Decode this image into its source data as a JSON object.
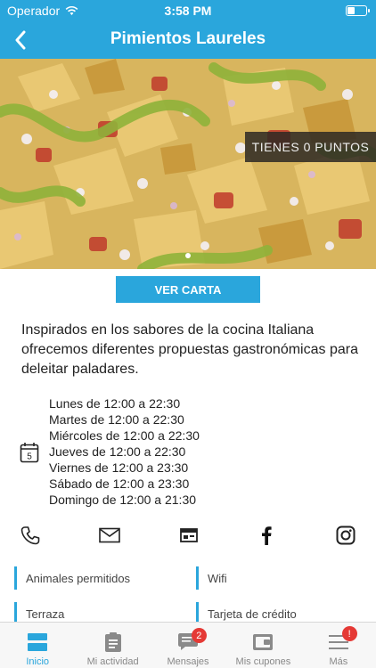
{
  "status_bar": {
    "carrier": "Operador",
    "time": "3:58 PM"
  },
  "nav": {
    "title": "Pimientos Laureles"
  },
  "hero": {
    "points_label": "TIENES 0 PUNTOS",
    "slide_count": 1,
    "active_slide": 1
  },
  "menu_button": {
    "label": "VER CARTA"
  },
  "description": "Inspirados en los sabores de la cocina Italiana ofrecemos diferentes propuestas gastronómicas para deleitar paladares.",
  "schedule": {
    "icon": "calendar-icon",
    "icon_day": "5",
    "lines": [
      "Lunes de 12:00 a 22:30",
      "Martes de 12:00 a 22:30",
      "Miércoles de 12:00 a 22:30",
      "Jueves de 12:00 a 22:30",
      "Viernes de 12:00 a 23:30",
      "Sábado de 12:00 a 23:30",
      "Domingo de 12:00 a 21:30"
    ]
  },
  "contact_icons": [
    "phone-icon",
    "mail-icon",
    "website-icon",
    "facebook-icon",
    "instagram-icon"
  ],
  "features": [
    "Animales permitidos",
    "Wifi",
    "Terraza",
    "Tarjeta de crédito"
  ],
  "tabs": [
    {
      "label": "Inicio",
      "icon": "home-icon",
      "active": true
    },
    {
      "label": "Mi actividad",
      "icon": "clipboard-icon"
    },
    {
      "label": "Mensajes",
      "icon": "chat-icon",
      "badge": "2"
    },
    {
      "label": "Mis cupones",
      "icon": "wallet-icon"
    },
    {
      "label": "Más",
      "icon": "menu-icon",
      "badge": "!"
    }
  ],
  "colors": {
    "primary": "#2aa6dc",
    "badge": "#e53935"
  }
}
